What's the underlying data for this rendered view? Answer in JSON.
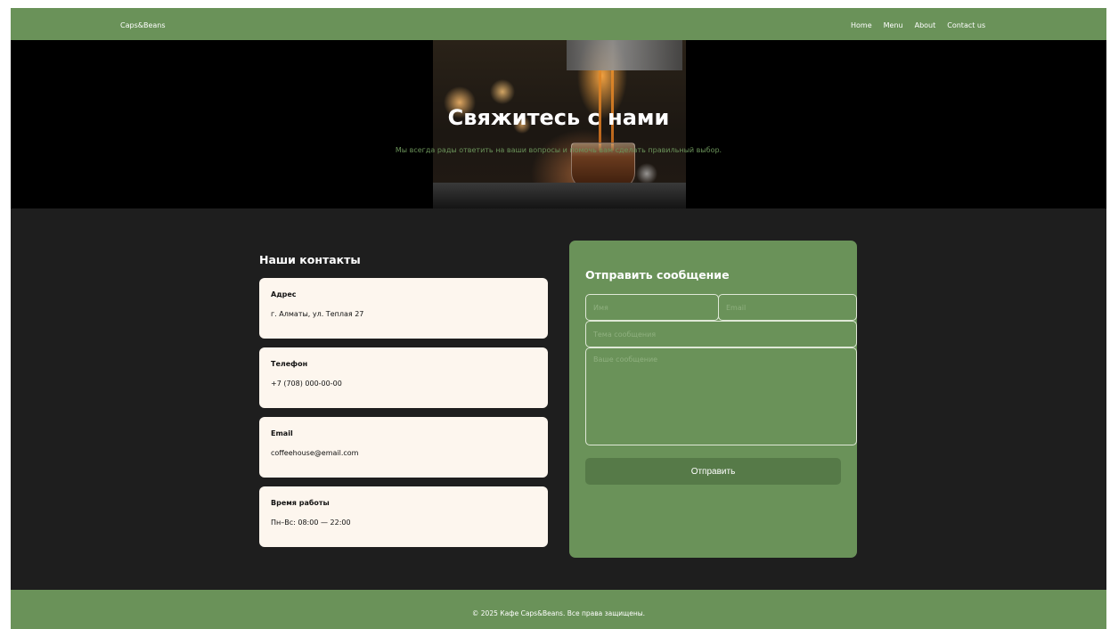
{
  "nav": {
    "brand": "Caps&Beans",
    "links": [
      "Home",
      "Menu",
      "About",
      "Contact us"
    ]
  },
  "hero": {
    "title": "Свяжитесь с нами",
    "subtitle": "Мы всегда рады ответить на ваши вопросы и помочь вам сделать правильный выбор."
  },
  "contacts": {
    "heading": "Наши контакты",
    "items": [
      {
        "label": "Адрес",
        "value": "г. Алматы, ул. Теплая 27"
      },
      {
        "label": "Телефон",
        "value": "+7 (708) 000-00-00"
      },
      {
        "label": "Email",
        "value": "coffeehouse@email.com"
      },
      {
        "label": "Время работы",
        "value": "Пн–Вс: 08:00 — 22:00"
      }
    ]
  },
  "form": {
    "title": "Отправить сообщение",
    "name_placeholder": "Имя",
    "email_placeholder": "Email",
    "subject_placeholder": "Тема сообщения",
    "message_placeholder": "Ваше сообщение",
    "submit_label": "Отправить"
  },
  "footer": {
    "text": "© 2025 Кафе Caps&Beans. Все права защищены."
  },
  "colors": {
    "accent_green": "#6a9259",
    "background": "#1e1e1e",
    "card": "#fdf6ee",
    "button": "#567a48"
  }
}
